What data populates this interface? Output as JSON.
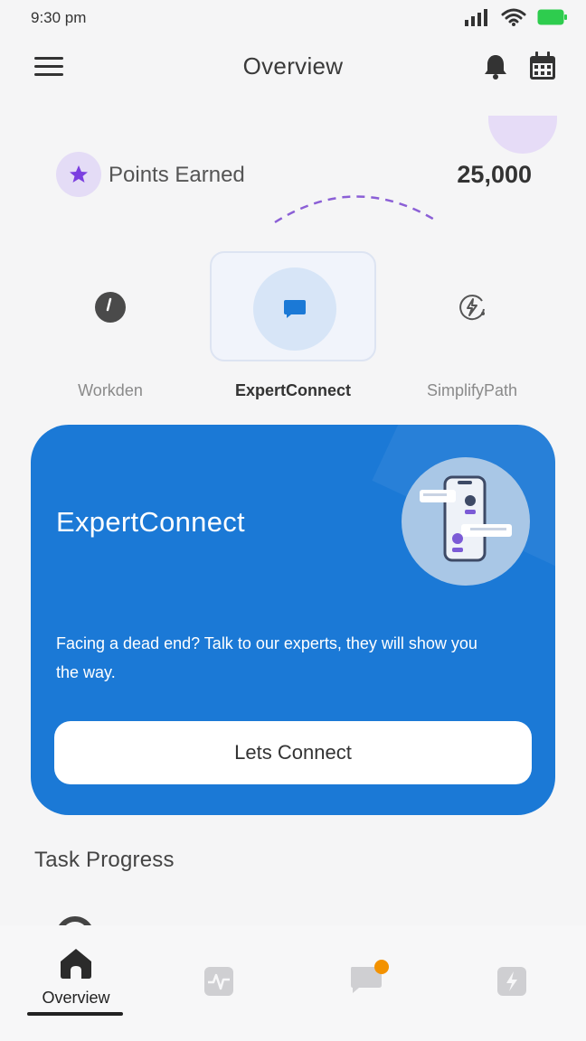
{
  "status_bar": {
    "time": "9:30 pm"
  },
  "header": {
    "title": "Overview"
  },
  "points": {
    "label": "Points Earned",
    "value": "25,000"
  },
  "tabs": [
    {
      "label": "Workden",
      "icon": "clock-icon"
    },
    {
      "label": "ExpertConnect",
      "icon": "chat-icon",
      "selected": true
    },
    {
      "label": "SimplifyPath",
      "icon": "lightning-icon"
    }
  ],
  "promo": {
    "title": "ExpertConnect",
    "description": "Facing a dead end? Talk to our experts, they will show you the way.",
    "button": "Lets Connect",
    "illustration": "phone-chat-illustration"
  },
  "task_progress": {
    "title": "Task Progress"
  },
  "bottom_nav": {
    "items": [
      {
        "label": "Overview",
        "icon": "home-icon",
        "active": true
      },
      {
        "label": "",
        "icon": "activity-icon"
      },
      {
        "label": "",
        "icon": "message-icon",
        "badge": true
      },
      {
        "label": "",
        "icon": "energy-icon"
      }
    ]
  },
  "colors": {
    "accent": "#1b79d6",
    "badge": "#f39200",
    "star": "#7b3fe0"
  }
}
